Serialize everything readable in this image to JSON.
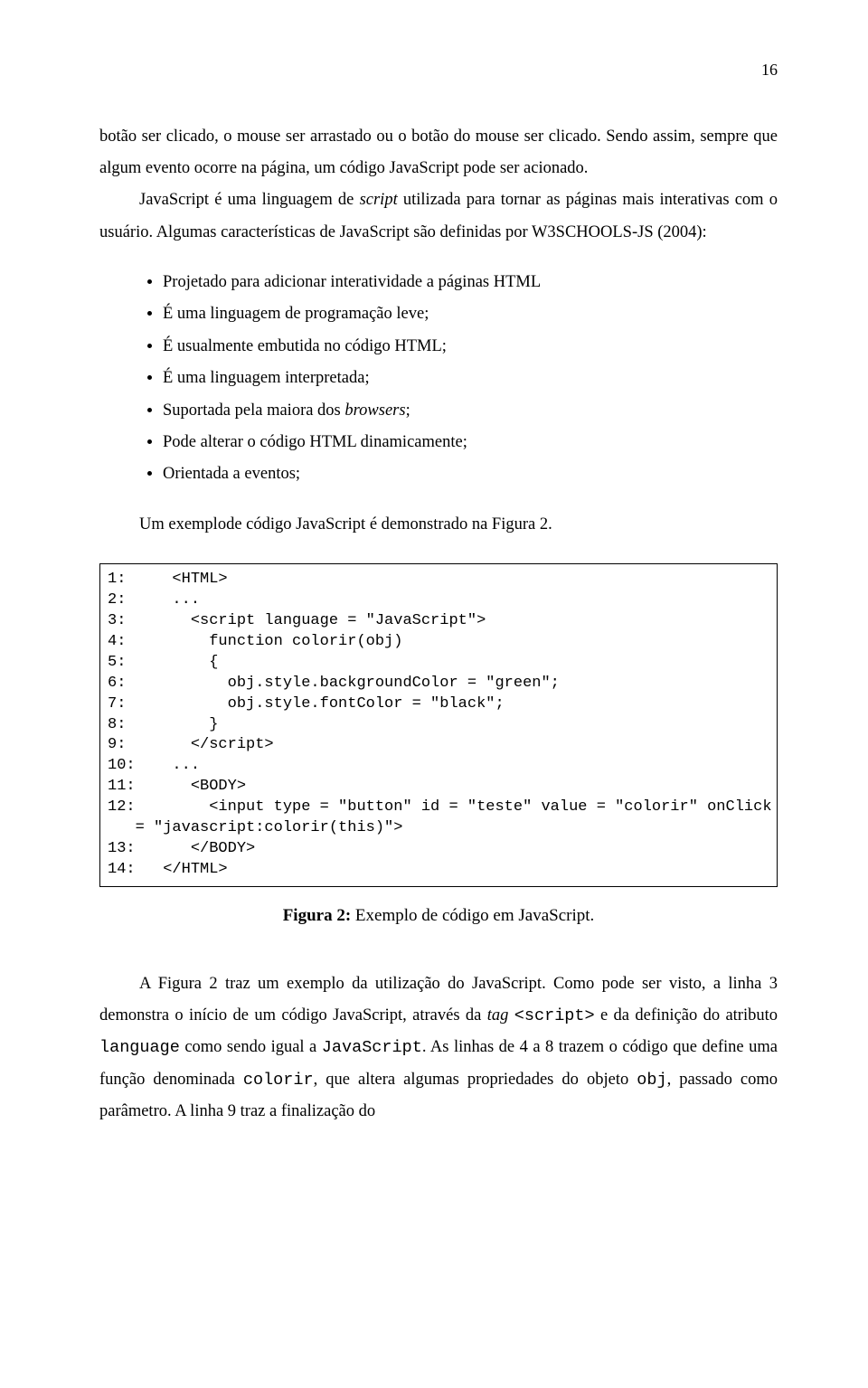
{
  "page_number": "16",
  "para1_html": "botão ser clicado, o mouse ser arrastado ou o botão do mouse ser clicado. Sendo assim, sempre que algum evento ocorre na página, um código JavaScript pode ser acionado.",
  "para2_html": "JavaScript é uma linguagem de <span class=\"italic\">script</span> utilizada para tornar as páginas mais interativas com o usuário. Algumas características de JavaScript são definidas por W3SCHOOLS-JS (2004):",
  "bullets": [
    "Projetado para adicionar interatividade a páginas HTML",
    "É uma linguagem de programação leve;",
    "É usualmente embutida no código HTML;",
    "É uma linguagem interpretada;",
    "Suportada pela maiora dos <span class=\"italic\">browsers</span>;",
    "Pode alterar o código HTML dinamicamente;",
    "Orientada a eventos;"
  ],
  "para3_html": "Um exemplode código JavaScript é demonstrado na Figura 2.",
  "code_block": "1:     <HTML>\n2:     ...\n3:       <script language = \"JavaScript\">\n4:         function colorir(obj)\n5:         {\n6:           obj.style.backgroundColor = \"green\";\n7:           obj.style.fontColor = \"black\";\n8:         }\n9:       </script>\n10:    ...\n11:      <BODY>\n12:        <input type = \"button\" id = \"teste\" value = \"colorir\" onClick\n   = \"javascript:colorir(this)\">\n13:      </BODY>\n14:   </HTML>",
  "figure_label": "Figura 2:",
  "figure_caption": "Exemplo de código em JavaScript.",
  "para4_html": "A Figura 2 traz um exemplo da utilização do JavaScript. Como pode ser visto, a linha 3 demonstra o início de um código JavaScript, através da <span class=\"italic\">tag</span> <span class=\"code-inline\">&lt;script&gt;</span> e da definição do atributo <span class=\"code-inline\">language</span> como sendo igual a <span class=\"code-inline\">JavaScript</span>. As linhas de 4 a 8 trazem o código que define uma função denominada <span class=\"code-inline\">colorir</span>, que altera algumas propriedades do objeto <span class=\"code-inline\">obj</span>, passado como parâmetro. A linha 9 traz a finalização do"
}
